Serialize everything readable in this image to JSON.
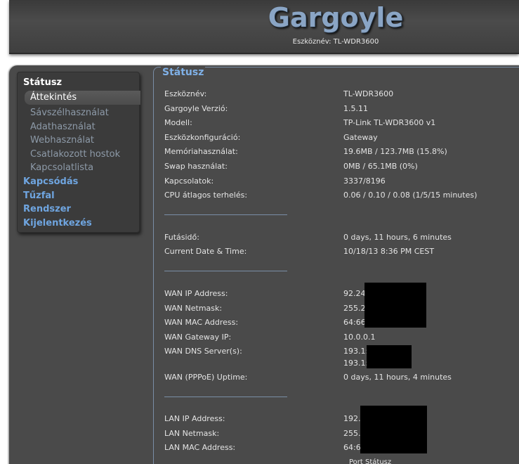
{
  "header": {
    "brand": "Gargoyle",
    "device_label": "Eszköznév: TL-WDR3600"
  },
  "menu": {
    "section_status": "Státusz",
    "status_items": [
      "Áttekintés",
      "Sávszélhasználat",
      "Adathasználat",
      "Webhasználat",
      "Csatlakozott hostok",
      "Kapcsolatlista"
    ],
    "sections": [
      "Kapcsódás",
      "Tűzfal",
      "Rendszer",
      "Kijelentkezés"
    ]
  },
  "panel": {
    "title": "Státusz",
    "device": [
      {
        "label": "Eszköznév:",
        "value": "TL-WDR3600"
      },
      {
        "label": "Gargoyle Verzió:",
        "value": "1.5.11"
      },
      {
        "label": "Modell:",
        "value": "TP-Link TL-WDR3600 v1"
      },
      {
        "label": "Eszközkonfiguráció:",
        "value": "Gateway"
      },
      {
        "label": "Memóriahasználat:",
        "value": "19.6MB / 123.7MB (15.8%)"
      },
      {
        "label": "Swap használat:",
        "value": "0MB / 65.1MB (0%)"
      },
      {
        "label": "Kapcsolatok:",
        "value": "3337/8196"
      },
      {
        "label": "CPU átlagos terhelés:",
        "value": "0.06 / 0.10 / 0.08  (1/5/15 minutes)"
      }
    ],
    "time": [
      {
        "label": "Futásidő:",
        "value": "0 days, 11 hours, 6 minutes"
      },
      {
        "label": "Current Date & Time:",
        "value": "10/18/13 8:36 PM CEST"
      }
    ],
    "wan": [
      {
        "label": "WAN IP Address:",
        "value": "92.24"
      },
      {
        "label": "WAN Netmask:",
        "value": "255.2"
      },
      {
        "label": "WAN MAC Address:",
        "value": "64:66"
      },
      {
        "label": "WAN Gateway IP:",
        "value": "10.0.0.1"
      },
      {
        "label": "WAN DNS Server(s):",
        "value": "193.1:"
      },
      {
        "label": "",
        "value": "193.1:"
      },
      {
        "label": "WAN (PPPoE) Uptime:",
        "value": "0 days, 11 hours, 4 minutes"
      }
    ],
    "lan": [
      {
        "label": "LAN IP Address:",
        "value": "192."
      },
      {
        "label": "LAN Netmask:",
        "value": "255."
      },
      {
        "label": "LAN MAC Address:",
        "value": "64:6"
      }
    ],
    "table_header": "Port   Státusz"
  },
  "colors": {
    "accent": "#7fb0e6",
    "brand": "#8aa5c5",
    "link": "#6fa5e0",
    "background": "#4a4a4a"
  }
}
